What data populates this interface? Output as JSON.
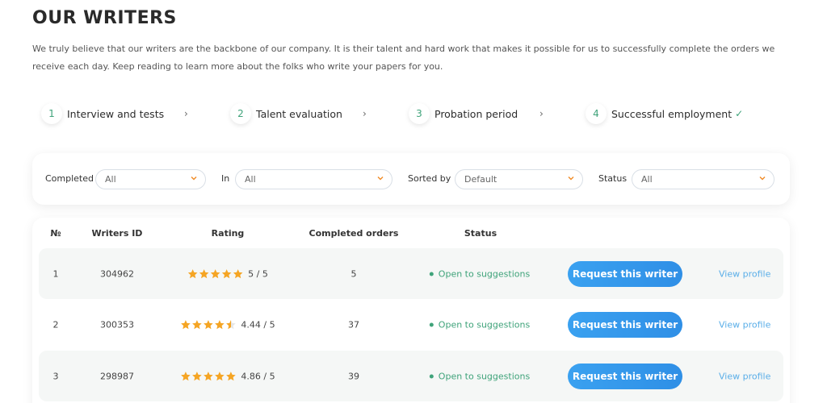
{
  "header": {
    "title": "OUR WRITERS",
    "intro": "We truly believe that our writers are the backbone of our company. It is their talent and hard work that makes it possible for us to successfully complete the orders we receive each day. Keep reading to learn more about the folks who write your papers for you."
  },
  "steps": [
    {
      "num": "1",
      "label": "Interview and tests"
    },
    {
      "num": "2",
      "label": "Talent evaluation"
    },
    {
      "num": "3",
      "label": "Probation period"
    },
    {
      "num": "4",
      "label": "Successful employment",
      "check": "✓"
    }
  ],
  "filters": {
    "completed": {
      "label": "Completed",
      "value": "All"
    },
    "in": {
      "label": "In",
      "value": "All"
    },
    "sorted": {
      "label": "Sorted by",
      "value": "Default"
    },
    "status": {
      "label": "Status",
      "value": "All"
    }
  },
  "table": {
    "headers": {
      "num": "№",
      "id": "Writers ID",
      "rating": "Rating",
      "orders": "Completed orders",
      "status": "Status"
    },
    "button_label": "Request this writer",
    "view_label": "View profile",
    "rows": [
      {
        "num": "1",
        "id": "304962",
        "rating": 5,
        "rating_text": "5 / 5",
        "orders": "5",
        "status": "Open to suggestions"
      },
      {
        "num": "2",
        "id": "300353",
        "rating": 4.44,
        "rating_text": "4.44 / 5",
        "orders": "37",
        "status": "Open to suggestions"
      },
      {
        "num": "3",
        "id": "298987",
        "rating": 4.86,
        "rating_text": "4.86 / 5",
        "orders": "39",
        "status": "Open to suggestions"
      }
    ]
  },
  "colors": {
    "accent_green": "#3fa37a",
    "star": "#f5a524",
    "button": "#2f8fe6",
    "link": "#5aaee8"
  }
}
